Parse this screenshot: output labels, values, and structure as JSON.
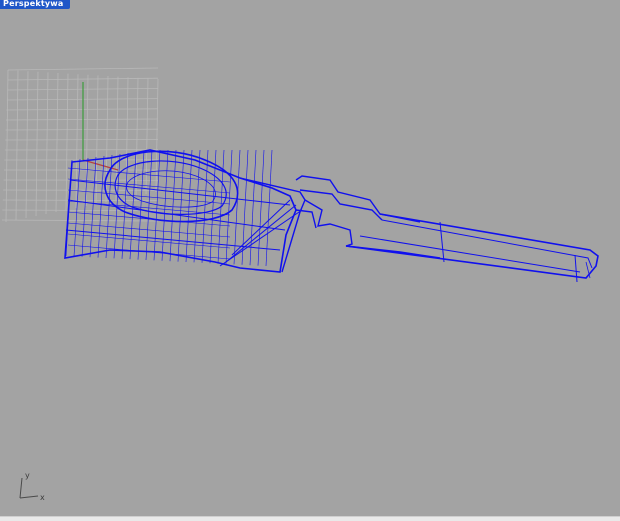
{
  "viewport": {
    "title": "Perspektywa",
    "background_color": "#a3a3a3",
    "tab_color": "#1f57c8"
  },
  "scene": {
    "grid_color": "#b8b8b8",
    "grid_visible": true,
    "x_axis_color": "#b44040",
    "y_axis_color": "#3c9c3c",
    "wireframe_color": "#1010ee",
    "object_icon": "wireframe-object-icon"
  },
  "axis_indicator": {
    "y_label": "y",
    "x_label": "x"
  }
}
